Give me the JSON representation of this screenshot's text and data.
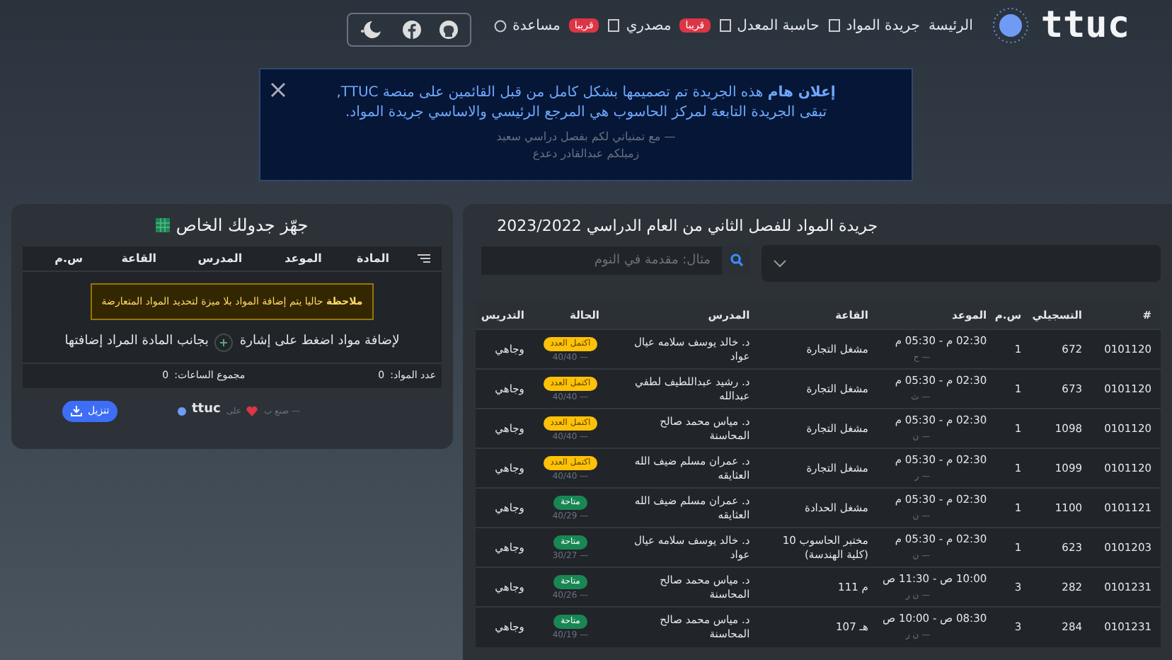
{
  "nav": {
    "logo": "ttuc",
    "links": [
      {
        "label": "الرئيسة"
      },
      {
        "label": "جريدة المواد"
      },
      {
        "label": "حاسبة المعدل",
        "badge": "قريبا"
      },
      {
        "label": "مصدري",
        "badge": "قريبا"
      },
      {
        "label": "مساعدة"
      }
    ]
  },
  "notice": {
    "text": "**إعلان هام** هذه الجريدة تم تصميمها بشكل كامل من قبل القائمين على منصة TTUC,\nتبقى الجريدة التابعة لمركز الحاسوب هي المرجع الرئيسي والاساسي جريدة المواد.",
    "signature": "— مع تمنياتي لكم بفصل دراسي سعيد",
    "author": "زميلكم عبدالقادر دعدع"
  },
  "schedule": {
    "title": "جهّز جدولك الخاص",
    "columns": [
      "المادة",
      "الموعد",
      "المدرس",
      "القاعة",
      "س.م"
    ],
    "note": "**ملاحظة** حاليا يتم إضافة المواد بلا ميزة لتحديد المواد المتعارضة",
    "hint_before": "لإضافة مواد اضغط على إشارة",
    "hint_after": "بجانب المادة المراد إضافتها",
    "count_label": "عدد المواد:",
    "count": "0",
    "hours_label": "مجموع الساعات:",
    "hours": "0",
    "credit": "— صنع ب",
    "credit_on": "على",
    "credit_logo": "ttuc",
    "download": "تنزيل"
  },
  "courses": {
    "title": "جريدة المواد للفصل الثاني من العام الدراسي 2023/2022",
    "search": {
      "placeholder": "مثال: مقدمة في النوم"
    },
    "columns": [
      "#",
      "التسجيلي",
      "س.م",
      "الموعد",
      "القاعة",
      "المدرس",
      "الحالة",
      "التدريس"
    ],
    "rows": [
      {
        "code": "0101120",
        "reg": "672",
        "hours": "1",
        "time": "02:30 م - 05:30 م",
        "days": "— ح",
        "room": "مشغل التجارة",
        "teacher": "د. خالد يوسف سلامه عيال عواد",
        "status": "اكتمل العدد",
        "kind": "full",
        "seats": "— 40/40",
        "mode": "وجاهي"
      },
      {
        "code": "0101120",
        "reg": "673",
        "hours": "1",
        "time": "02:30 م - 05:30 م",
        "days": "— ث",
        "room": "مشغل التجارة",
        "teacher": "د. رشيد عبداللطيف لطفي عبدالله",
        "status": "اكتمل العدد",
        "kind": "full",
        "seats": "— 40/40",
        "mode": "وجاهي"
      },
      {
        "code": "0101120",
        "reg": "1098",
        "hours": "1",
        "time": "02:30 م - 05:30 م",
        "days": "— ن",
        "room": "مشغل التجارة",
        "teacher": "د. مياس محمد صالح المحاسنة",
        "status": "اكتمل العدد",
        "kind": "full",
        "seats": "— 40/40",
        "mode": "وجاهي"
      },
      {
        "code": "0101120",
        "reg": "1099",
        "hours": "1",
        "time": "02:30 م - 05:30 م",
        "days": "— ر",
        "room": "مشغل التجارة",
        "teacher": "د. عمران مسلم ضيف الله العثايقه",
        "status": "اكتمل العدد",
        "kind": "full",
        "seats": "— 40/40",
        "mode": "وجاهي"
      },
      {
        "code": "0101121",
        "reg": "1100",
        "hours": "1",
        "time": "02:30 م - 05:30 م",
        "days": "— ن",
        "room": "مشغل الحدادة",
        "teacher": "د. عمران مسلم ضيف الله العثايقه",
        "status": "متاحة",
        "kind": "available",
        "seats": "— 40/29",
        "mode": "وجاهي"
      },
      {
        "code": "0101203",
        "reg": "623",
        "hours": "1",
        "time": "02:30 م - 05:30 م",
        "days": "— ن",
        "room": "مختبر الحاسوب 10 (كلية الهندسة)",
        "teacher": "د. خالد يوسف سلامه عيال عواد",
        "status": "متاحة",
        "kind": "available",
        "seats": "— 30/27",
        "mode": "وجاهي"
      },
      {
        "code": "0101231",
        "reg": "282",
        "hours": "3",
        "time": "10:00 ص - 11:30 ص",
        "days": "— ن ر",
        "room": "م 111",
        "teacher": "د. مياس محمد صالح المحاسنة",
        "status": "متاحة",
        "kind": "available",
        "seats": "— 40/26",
        "mode": "وجاهي"
      },
      {
        "code": "0101231",
        "reg": "284",
        "hours": "3",
        "time": "08:30 ص - 10:00 ص",
        "days": "— ن ر",
        "room": "هـ 107",
        "teacher": "د. مياس محمد صالح المحاسنة",
        "status": "متاحة",
        "kind": "available",
        "seats": "— 40/19",
        "mode": "وجاهي"
      }
    ]
  }
}
